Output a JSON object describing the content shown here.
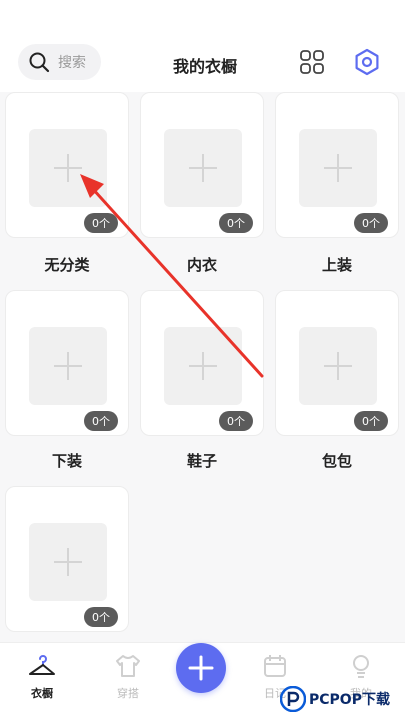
{
  "header": {
    "search_placeholder": "搜索",
    "title": "我的衣橱",
    "icons": [
      "search-icon",
      "grid-icon",
      "settings-icon"
    ]
  },
  "categories": [
    {
      "label": "无分类",
      "count": "0个"
    },
    {
      "label": "内衣",
      "count": "0个"
    },
    {
      "label": "上装",
      "count": "0个"
    },
    {
      "label": "下装",
      "count": "0个"
    },
    {
      "label": "鞋子",
      "count": "0个"
    },
    {
      "label": "包包",
      "count": "0个"
    },
    {
      "label": "",
      "count": "0个"
    }
  ],
  "tabbar": {
    "tabs": [
      {
        "label": "衣橱",
        "icon": "hanger-icon",
        "active": true
      },
      {
        "label": "穿搭",
        "icon": "shirt-icon",
        "active": false
      },
      {
        "label": "",
        "icon": "add-icon",
        "active": false
      },
      {
        "label": "日记",
        "icon": "calendar-icon",
        "active": false
      },
      {
        "label": "我的",
        "icon": "bulb-icon",
        "active": false
      }
    ]
  },
  "watermark": {
    "text": "PCPOP下载"
  },
  "colors": {
    "accent": "#5d6cf0",
    "badge": "#5b5b5b",
    "arrow": "#e8332a",
    "background": "#f7f7f8"
  }
}
